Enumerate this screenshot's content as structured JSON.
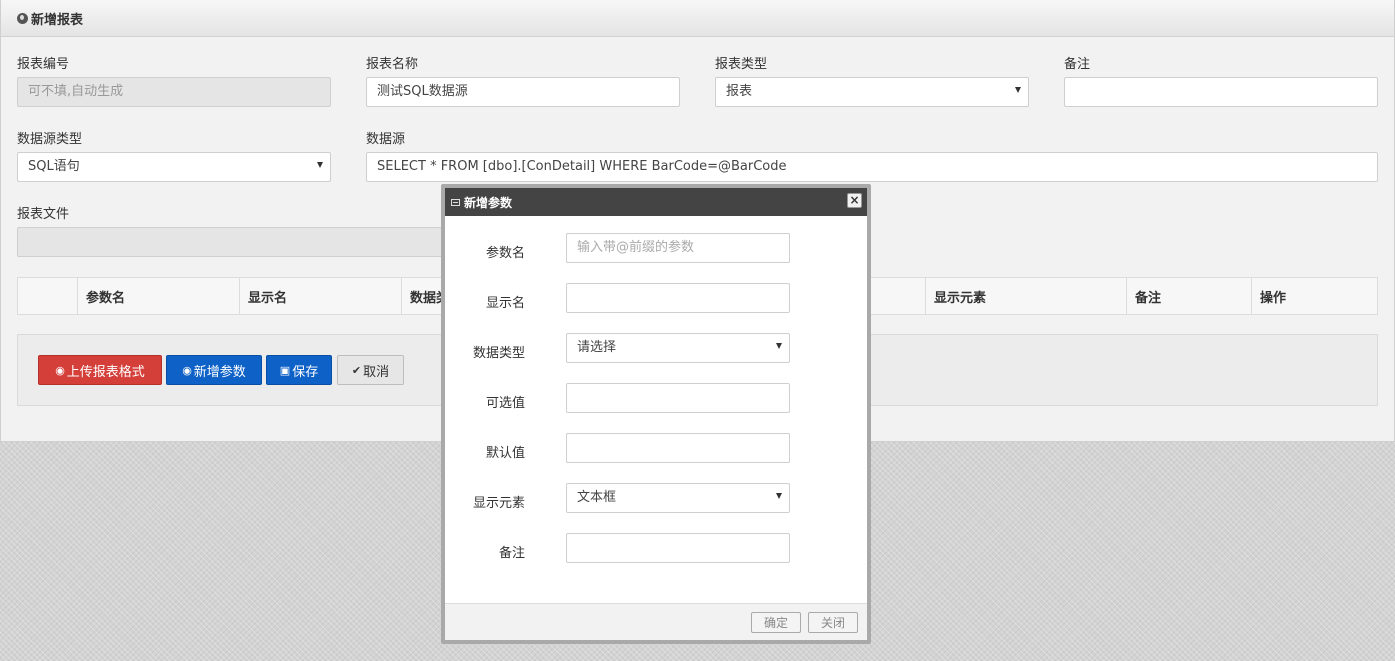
{
  "panel": {
    "title": "新增报表"
  },
  "form": {
    "report_no": {
      "label": "报表编号",
      "placeholder": "可不填,自动生成"
    },
    "report_name": {
      "label": "报表名称",
      "value": "测试SQL数据源"
    },
    "report_type": {
      "label": "报表类型",
      "value": "报表"
    },
    "remark": {
      "label": "备注",
      "value": ""
    },
    "datasource_type": {
      "label": "数据源类型",
      "value": "SQL语句"
    },
    "datasource": {
      "label": "数据源",
      "value": "SELECT * FROM [dbo].[ConDetail] WHERE BarCode=@BarCode"
    },
    "report_file": {
      "label": "报表文件",
      "value": ""
    }
  },
  "grid": {
    "columns": [
      "",
      "参数名",
      "显示名",
      "数据类",
      "",
      "",
      "显示元素",
      "备注",
      "操作"
    ]
  },
  "toolbar": {
    "upload_label": "上传报表格式",
    "add_param_label": "新增参数",
    "save_label": "保存",
    "cancel_label": "取消"
  },
  "modal": {
    "title": "新增参数",
    "close_symbol": "×",
    "fields": {
      "param_name": {
        "label": "参数名",
        "placeholder": "输入带@前缀的参数"
      },
      "display_name": {
        "label": "显示名",
        "value": ""
      },
      "data_type": {
        "label": "数据类型",
        "value": "请选择"
      },
      "options": {
        "label": "可选值",
        "value": ""
      },
      "default_value": {
        "label": "默认值",
        "value": ""
      },
      "display_element": {
        "label": "显示元素",
        "value": "文本框"
      },
      "remark": {
        "label": "备注",
        "value": ""
      }
    },
    "ok_label": "确定",
    "close_label": "关闭"
  },
  "colors": {
    "danger": "#d43f3a",
    "primary": "#0e62c7",
    "modal_title_bg": "#444444"
  }
}
